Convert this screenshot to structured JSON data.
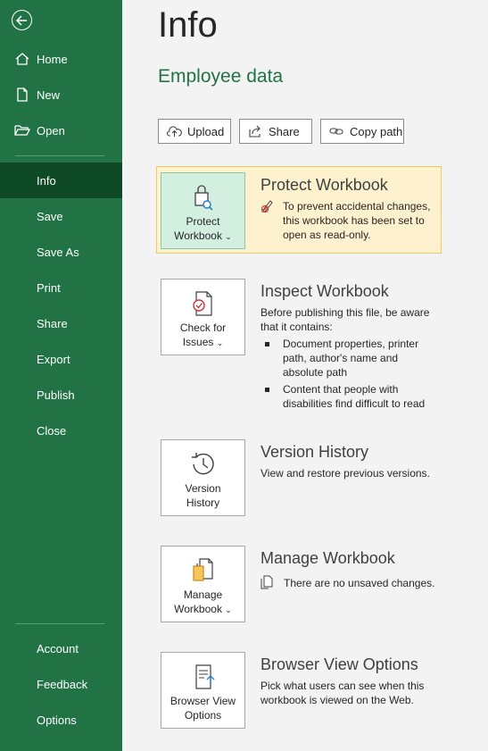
{
  "sidebar": {
    "back_icon": "back-arrow-icon",
    "items_top": [
      {
        "label": "Home",
        "icon": "home-icon"
      },
      {
        "label": "New",
        "icon": "new-document-icon"
      },
      {
        "label": "Open",
        "icon": "open-folder-icon"
      }
    ],
    "items_main": [
      {
        "label": "Info",
        "active": true
      },
      {
        "label": "Save"
      },
      {
        "label": "Save As"
      },
      {
        "label": "Print"
      },
      {
        "label": "Share"
      },
      {
        "label": "Export"
      },
      {
        "label": "Publish"
      },
      {
        "label": "Close"
      }
    ],
    "items_bottom": [
      {
        "label": "Account"
      },
      {
        "label": "Feedback"
      },
      {
        "label": "Options"
      }
    ]
  },
  "main": {
    "title": "Info",
    "document_name": "Employee data",
    "toolbar": {
      "upload_label": "Upload",
      "share_label": "Share",
      "copy_path_label": "Copy path"
    },
    "protect": {
      "button_line1": "Protect",
      "button_line2": "Workbook",
      "title": "Protect Workbook",
      "text_line1": "To prevent accidental changes,",
      "text_line2": "this workbook has been set to",
      "text_line3": "open as read-only."
    },
    "inspect": {
      "button_line1": "Check for",
      "button_line2": "Issues",
      "title": "Inspect Workbook",
      "text_line1": "Before publishing this file, be aware",
      "text_line2": "that it contains:",
      "bullet1_line1": "Document properties, printer",
      "bullet1_line2": "path, author's name and",
      "bullet1_line3": "absolute path",
      "bullet2_line1": "Content that people with",
      "bullet2_line2": "disabilities find difficult to read"
    },
    "version": {
      "button_line1": "Version",
      "button_line2": "History",
      "title": "Version History",
      "text": "View and restore previous versions."
    },
    "manage": {
      "button_line1": "Manage",
      "button_line2": "Workbook",
      "title": "Manage Workbook",
      "text": "There are no unsaved changes."
    },
    "browser": {
      "button_line1": "Browser View",
      "button_line2": "Options",
      "title": "Browser View Options",
      "text_line1": "Pick what users can see when this",
      "text_line2": "workbook is viewed on the Web."
    }
  },
  "colors": {
    "sidebar": "#217346",
    "sidebar_active": "#0f4a26",
    "accent": "#217346",
    "highlight_bg": "#fdf2cd",
    "highlight_border": "#f2c766"
  }
}
